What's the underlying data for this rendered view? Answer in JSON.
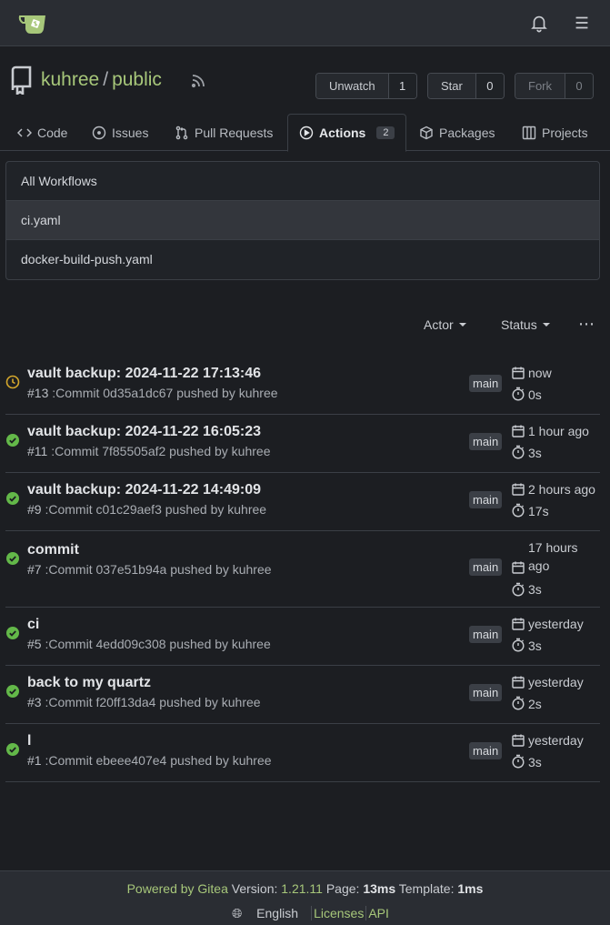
{
  "repo": {
    "owner": "kuhree",
    "separator": "/",
    "name": "public",
    "watch": {
      "label": "Unwatch",
      "count": "1"
    },
    "star": {
      "label": "Star",
      "count": "0"
    },
    "fork": {
      "label": "Fork",
      "count": "0"
    }
  },
  "tabs": {
    "code": "Code",
    "issues": "Issues",
    "pulls": "Pull Requests",
    "actions": "Actions",
    "actions_count": "2",
    "packages": "Packages",
    "projects": "Projects"
  },
  "workflows": {
    "all": "All Workflows",
    "items": [
      "ci.yaml",
      "docker-build-push.yaml"
    ]
  },
  "filters": {
    "actor": "Actor",
    "status": "Status"
  },
  "runs": [
    {
      "title": "vault backup: 2024-11-22 17:13:46",
      "num": "#13",
      "sub": " :Commit 0d35a1dc67 pushed by kuhree",
      "branch": "main",
      "time": "now",
      "duration": "0s",
      "status": "running"
    },
    {
      "title": "vault backup: 2024-11-22 16:05:23",
      "num": "#11",
      "sub": " :Commit 7f85505af2 pushed by kuhree",
      "branch": "main",
      "time": "1 hour ago",
      "duration": "3s",
      "status": "success"
    },
    {
      "title": "vault backup: 2024-11-22 14:49:09",
      "num": "#9",
      "sub": " :Commit c01c29aef3 pushed by kuhree",
      "branch": "main",
      "time": "2 hours ago",
      "duration": "17s",
      "status": "success"
    },
    {
      "title": "commit",
      "num": "#7",
      "sub": " :Commit 037e51b94a pushed by kuhree",
      "branch": "main",
      "time": "17 hours ago",
      "duration": "3s",
      "status": "success"
    },
    {
      "title": "ci",
      "num": "#5",
      "sub": " :Commit 4edd09c308 pushed by kuhree",
      "branch": "main",
      "time": "yesterday",
      "duration": "3s",
      "status": "success"
    },
    {
      "title": "back to my quartz",
      "num": "#3",
      "sub": " :Commit f20ff13da4 pushed by kuhree",
      "branch": "main",
      "time": "yesterday",
      "duration": "2s",
      "status": "success"
    },
    {
      "title": "l",
      "num": "#1",
      "sub": " :Commit ebeee407e4 pushed by kuhree",
      "branch": "main",
      "time": "yesterday",
      "duration": "3s",
      "status": "success"
    }
  ],
  "footer": {
    "powered": "Powered by Gitea",
    "version_label": " Version: ",
    "version": "1.21.11",
    "page_label": " Page: ",
    "page": "13ms",
    "template_label": " Template: ",
    "template": "1ms",
    "language": "English",
    "licenses": "Licenses",
    "api": "API"
  },
  "colors": {
    "success": "#63b849",
    "running": "#d4a72c",
    "accent": "#a7c77a"
  }
}
